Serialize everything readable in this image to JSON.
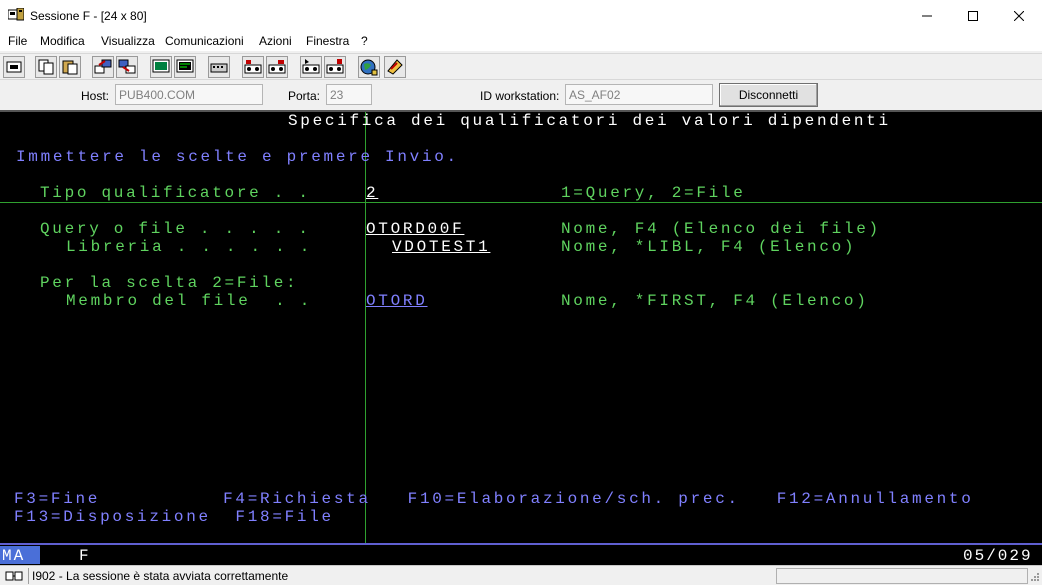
{
  "window": {
    "title": "Sessione F - [24 x 80]",
    "min_glyph": "—",
    "max_glyph": "☐",
    "close_glyph": "✕"
  },
  "menu": [
    {
      "label": "File"
    },
    {
      "label": "Modifica"
    },
    {
      "label": "Visualizza"
    },
    {
      "label": "Comunicazioni"
    },
    {
      "label": "Azioni"
    },
    {
      "label": "Finestra"
    },
    {
      "label": "?"
    }
  ],
  "toolbar": {
    "icons": [
      "print-screen-icon",
      "copy-icon",
      "paste-icon",
      "send-file-icon",
      "receive-file-icon",
      "display-icon",
      "keyboard-icon",
      "settings-icon",
      "macro-record-icon",
      "macro-play-icon",
      "macro-stop-icon",
      "macro-run-icon",
      "globe-icon",
      "help-icon"
    ]
  },
  "hostbar": {
    "host_label": "Host:",
    "host_value": "PUB400.COM",
    "port_label": "Porta:",
    "port_value": "23",
    "ws_label": "ID workstation:",
    "ws_value": "AS_AF02",
    "disconnect_label": "Disconnetti"
  },
  "screen": {
    "title": "Specifica dei qualificatori dei valori dipendenti",
    "instructions": "Immettere le scelte e premere Invio.",
    "tipo_label": "Tipo qualificatore . .",
    "tipo_value": "2",
    "tipo_help": "1=Query, 2=File",
    "query_label": "Query o file . . . . .",
    "query_value": "OTORD00F",
    "query_help": "Nome, F4 (Elenco dei file)",
    "libreria_label": "Libreria . . . . . .",
    "libreria_value": "VDOTEST1",
    "libreria_help": "Nome, *LIBL, F4 (Elenco)",
    "per_scelta": "Per la scelta 2=File:",
    "membro_label": "Membro del file  . .",
    "membro_value": "OTORD",
    "membro_help": "Nome, *FIRST, F4 (Elenco)",
    "fkeys_row1": "F3=Fine          F4=Richiesta   F10=Elaborazione/sch. prec.   F12=Annullamento",
    "fkeys_row2": "F13=Disposizione  F18=File"
  },
  "oia": {
    "mode": "MA",
    "session": "F",
    "cursor_pos": "05/029"
  },
  "status": {
    "message": "I902 - La sessione è stata avviata correttamente"
  }
}
